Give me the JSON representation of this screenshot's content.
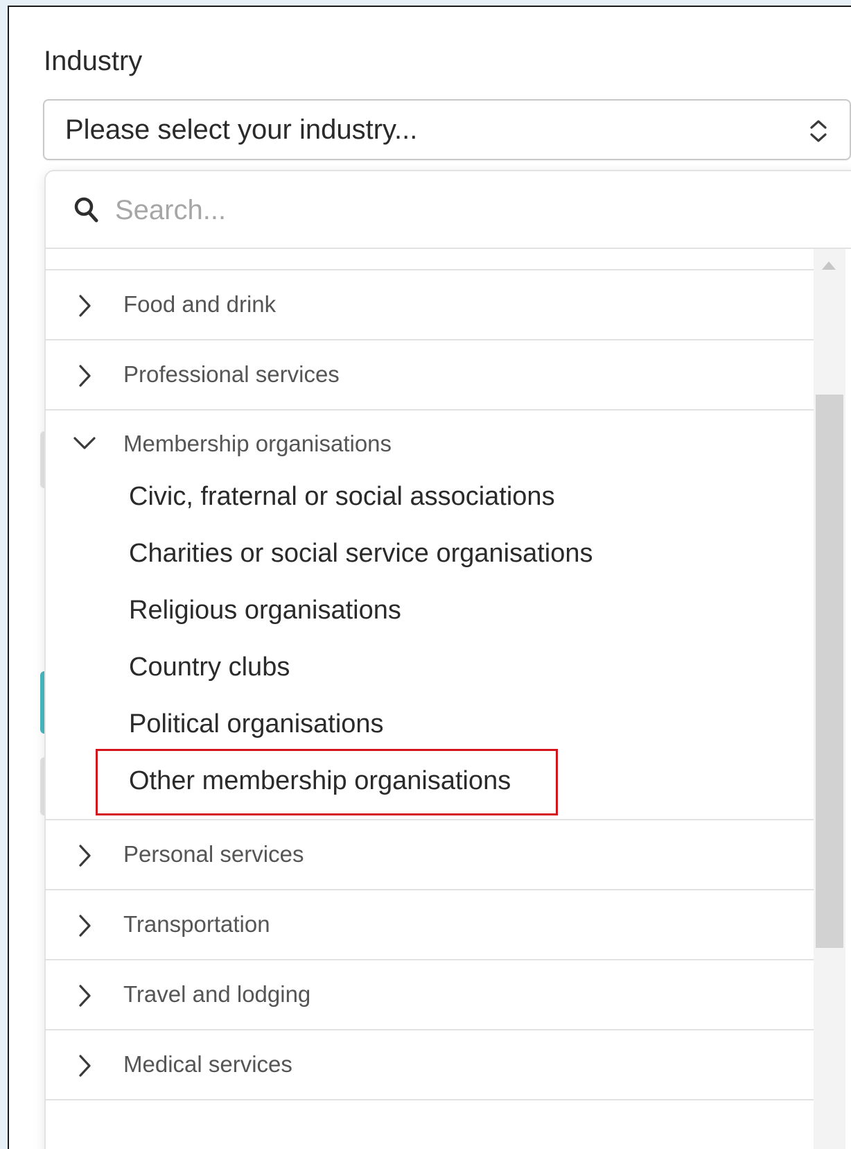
{
  "field": {
    "label": "Industry",
    "select_value": "Please select your industry..."
  },
  "search": {
    "placeholder": "Search..."
  },
  "categories": [
    {
      "label": "Food and drink",
      "expanded": false
    },
    {
      "label": "Professional services",
      "expanded": false
    },
    {
      "label": "Membership organisations",
      "expanded": true,
      "items": [
        "Civic, fraternal or social associations",
        "Charities or social service organisations",
        "Religious organisations",
        "Country clubs",
        "Political organisations",
        "Other membership organisations"
      ],
      "highlighted_item": "Other membership organisations"
    },
    {
      "label": "Personal services",
      "expanded": false
    },
    {
      "label": "Transportation",
      "expanded": false
    },
    {
      "label": "Travel and lodging",
      "expanded": false
    },
    {
      "label": "Medical services",
      "expanded": false
    }
  ],
  "colors": {
    "highlight": "#d4141c",
    "accent_remnant": "#4bb8c0"
  },
  "icons": {
    "select": "chevron-up-down-icon",
    "search": "search-icon",
    "collapsed": "chevron-right-icon",
    "expanded": "chevron-down-icon"
  }
}
